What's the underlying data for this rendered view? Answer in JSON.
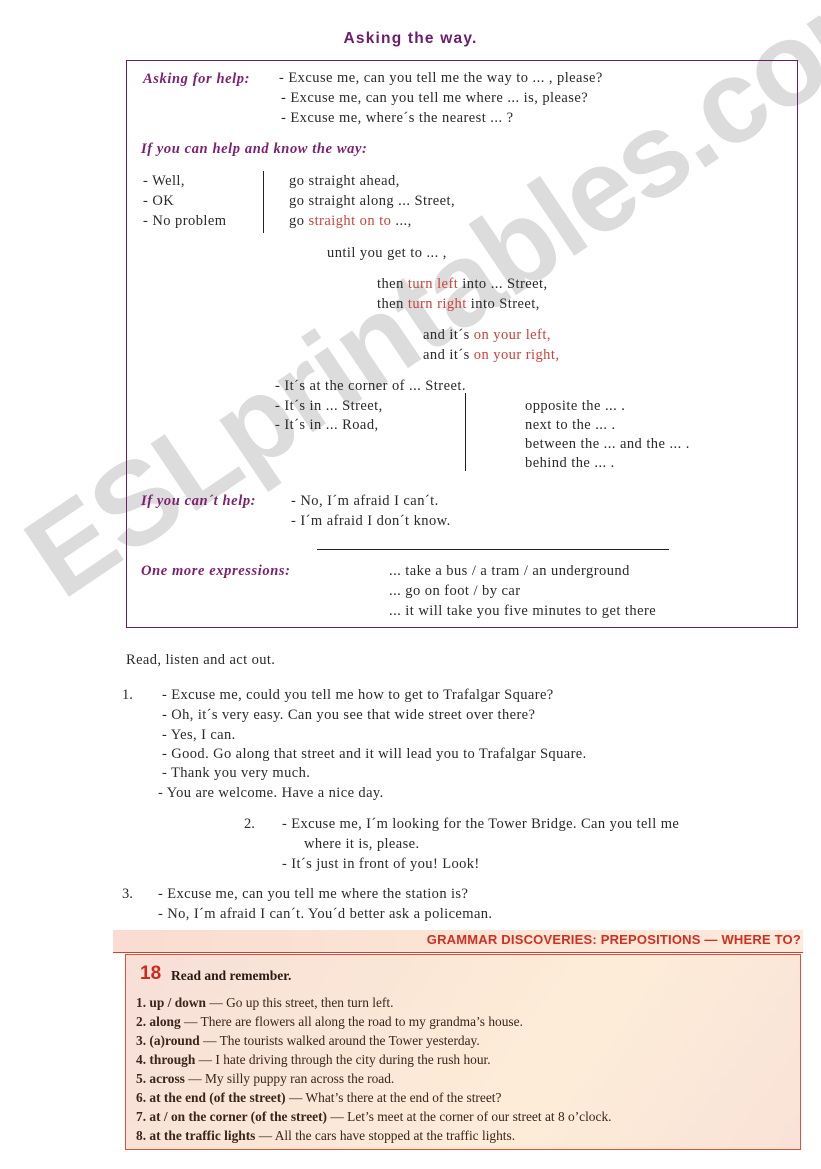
{
  "watermark": {
    "text": "ESLprintables.com"
  },
  "title": "Asking  the  way.",
  "phrase_box": {
    "sections": {
      "asking_for_help": {
        "heading": "Asking for help:",
        "lines": [
          "-  Excuse me, can you tell me  the  way to  ... , please?",
          "-  Excuse me, can you tell me  where   ...  is, please?",
          "-  Excuse me, where´s  the  nearest  ...  ?"
        ]
      },
      "if_you_can_help": {
        "heading": "If you can help and know the way:",
        "openers": [
          "-  Well,",
          "-  OK",
          "-  No problem"
        ],
        "go_lines": [
          {
            "pre": "go  straight  ahead,",
            "red": "",
            "post": ""
          },
          {
            "pre": "go  straight  along  ... Street,",
            "red": "",
            "post": ""
          },
          {
            "pre": "go  ",
            "red": "straight  on  to",
            "post": " ...,"
          }
        ],
        "until_line": "until  you  get  to  ... ,",
        "turn_lines": [
          {
            "pre": "then  ",
            "red": "turn    left",
            "post": "   into  ... Street,"
          },
          {
            "pre": "then  ",
            "red": "turn    right",
            "post": "  into   Street,"
          }
        ],
        "its_on_lines": [
          {
            "pre": "and  it´s  ",
            "red": "on your  left,",
            "post": ""
          },
          {
            "pre": "and  it´s  ",
            "red": "on your  right,",
            "post": ""
          }
        ],
        "location_lines": [
          "- It´s  at  the  corner  of  ...  Street.",
          "- It´s  in  ...  Street,",
          "- It´s  in  ...  Road,"
        ],
        "position_lines": [
          "opposite  the  ...  .",
          "next  to  the  ...  .",
          "between  the  ...  and  the  ... .",
          "behind  the  ...   ."
        ]
      },
      "if_you_cant_help": {
        "heading": "If you can´t help:",
        "lines": [
          "-  No,  I´m  afraid  I  can´t.",
          "-  I´m  afraid  I  don´t  know."
        ]
      },
      "one_more_expressions": {
        "heading": "One more expressions:",
        "lines": [
          "...  take  a  bus /  a  tram /  an  underground",
          "...   go  on  foot /  by  car",
          "...   it  will  take  you  five  minutes  to  get  there"
        ]
      }
    }
  },
  "dialogues": {
    "instruction": "Read,  listen  and  act  out.",
    "items": [
      {
        "number": "1.",
        "lines": [
          "-  Excuse  me,  could  you  tell  me  how  to  get  to  Trafalgar  Square?",
          "-  Oh,  it´s  very  easy.  Can  you  see  that  wide  street  over  there?",
          "-  Yes,  I  can.",
          "-  Good.  Go  along  that  street  and  it  will  lead  you  to  Trafalgar  Square.",
          "-  Thank  you  very  much.",
          "-  You  are  welcome.  Have  a  nice  day."
        ]
      },
      {
        "number": "2.",
        "lines": [
          "-    Excuse  me,  I´m  looking  for  the  Tower  Bridge.  Can  you  tell  me",
          "where  it  is,  please.",
          "-    It´s  just  in  front  of  you!  Look!"
        ]
      },
      {
        "number": "3.",
        "lines": [
          "-  Excuse  me,  can  you  tell  me  where  the  station  is?",
          "-  No,  I´m  afraid  I  can´t.  You´d  better  ask  a  policeman."
        ]
      }
    ]
  },
  "grammar": {
    "header": "GRAMMAR DISCOVERIES: PREPOSITIONS — WHERE TO?",
    "number": "18",
    "instruction": "Read and remember.",
    "items": [
      {
        "num": "1.",
        "term": "up / down",
        "dash": "—",
        "example": "Go up this street, then turn left."
      },
      {
        "num": "2.",
        "term": "along",
        "dash": "—",
        "example": "There are flowers all along the road to my grandma’s house."
      },
      {
        "num": "3.",
        "term": "(a)round",
        "dash": "—",
        "example": "The tourists walked around the Tower yesterday."
      },
      {
        "num": "4.",
        "term": "through",
        "dash": "—",
        "example": "I hate driving through the city during the rush hour."
      },
      {
        "num": "5.",
        "term": "across",
        "dash": "—",
        "example": "My silly puppy ran across the road."
      },
      {
        "num": "6.",
        "term": "at the end (of the street)",
        "dash": "—",
        "example": "What’s there at the end of the street?"
      },
      {
        "num": "7.",
        "term": "at / on the corner (of the street)",
        "dash": "—",
        "example": "Let’s meet at the corner of our street at 8 o’clock."
      },
      {
        "num": "8.",
        "term": "at the traffic lights",
        "dash": "—",
        "example": "All the cars have stopped at the traffic lights."
      }
    ]
  },
  "colors": {
    "title_purple": "#6b1d6b",
    "heading_magenta": "#7d1f6e",
    "accent_red": "#c8443c",
    "grammar_red": "#d02f22",
    "box_border_purple": "#6b1d6b"
  }
}
